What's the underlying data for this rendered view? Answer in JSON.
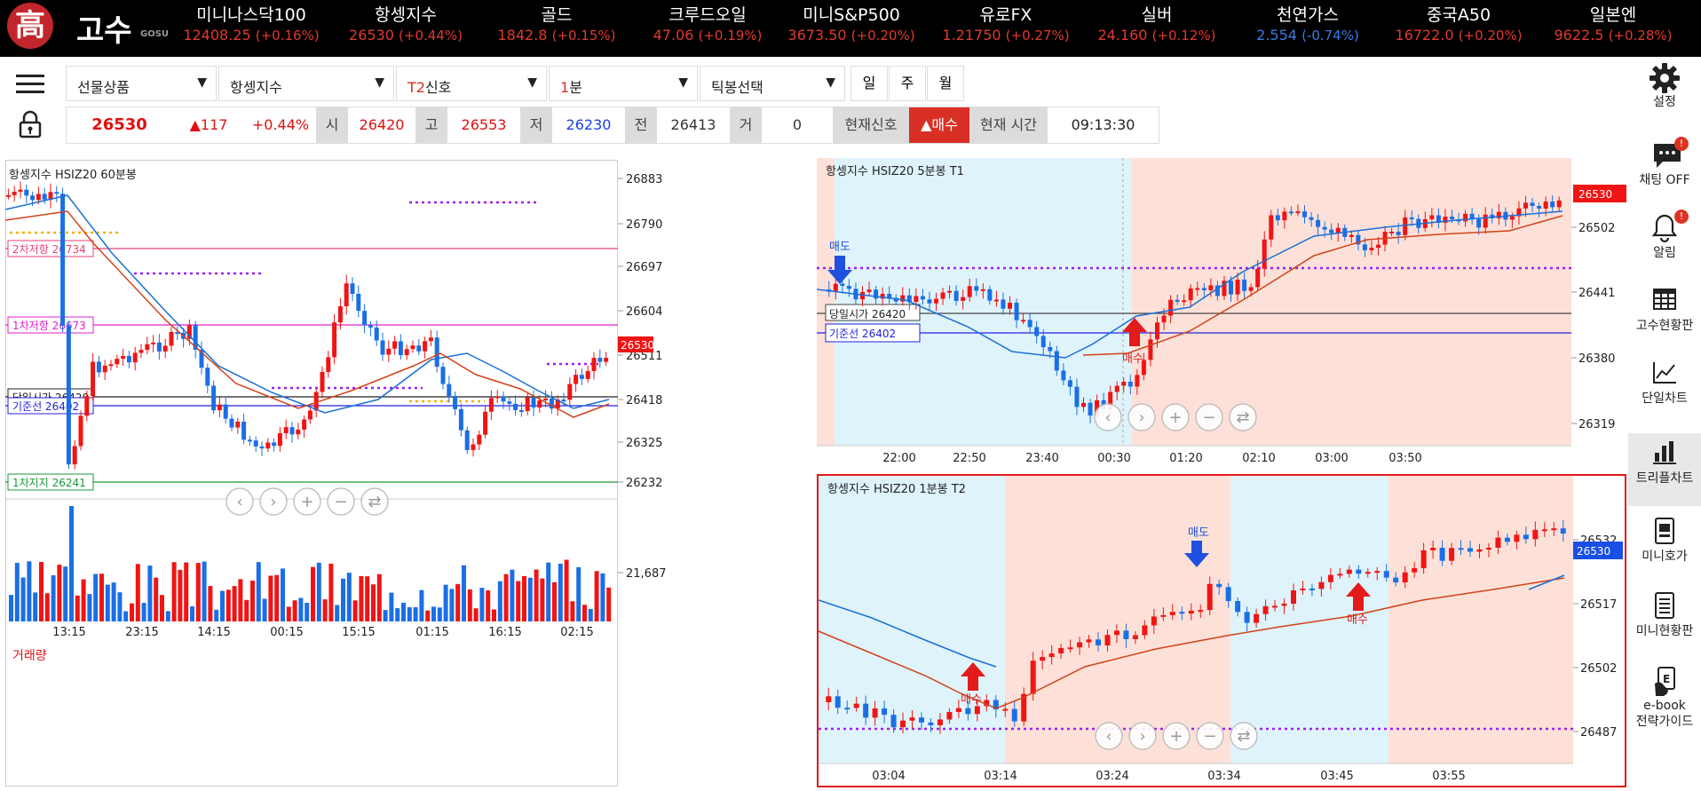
{
  "brand": {
    "logo_char": "高",
    "name": "고수",
    "sub": "GOSU"
  },
  "tickers": [
    {
      "name": "미니나스닥100",
      "price": "12408.25",
      "change": "(+0.16%)",
      "dir": "up"
    },
    {
      "name": "항셍지수",
      "price": "26530",
      "change": "(+0.44%)",
      "dir": "up"
    },
    {
      "name": "골드",
      "price": "1842.8",
      "change": "(+0.15%)",
      "dir": "up"
    },
    {
      "name": "크루드오일",
      "price": "47.06",
      "change": "(+0.19%)",
      "dir": "up"
    },
    {
      "name": "미니S&P500",
      "price": "3673.50",
      "change": "(+0.20%)",
      "dir": "up"
    },
    {
      "name": "유로FX",
      "price": "1.21750",
      "change": "(+0.27%)",
      "dir": "up"
    },
    {
      "name": "실버",
      "price": "24.160",
      "change": "(+0.12%)",
      "dir": "up"
    },
    {
      "name": "천연가스",
      "price": "2.554",
      "change": "(-0.74%)",
      "dir": "down"
    },
    {
      "name": "중국A50",
      "price": "16722.0",
      "change": "(+0.20%)",
      "dir": "up"
    },
    {
      "name": "일본엔",
      "price": "9622.5",
      "change": "(+0.28%)",
      "dir": "up"
    }
  ],
  "toolbar": {
    "product_label": "선물상품",
    "instrument": "항셍지수",
    "signal_prefix": "T2",
    "signal_suffix": "신호",
    "interval_prefix": "1",
    "interval_suffix": "분",
    "tick_select": "틱봉선택",
    "tabs": [
      "일",
      "주",
      "월"
    ]
  },
  "quote": {
    "price": "26530",
    "change": "▲117",
    "change_pct": "+0.44%",
    "open_label": "시",
    "open": "26420",
    "high_label": "고",
    "high": "26553",
    "low_label": "저",
    "low": "26230",
    "prev_label": "전",
    "prev": "26413",
    "volume_label": "거",
    "volume": "0",
    "signal_label": "현재신호",
    "signal_value": "▲매수",
    "time_label": "현재 시간",
    "time_value": "09:13:30"
  },
  "colors": {
    "up": "#f01414",
    "down": "#1a6fe6",
    "buy_zone": "#fde1d8",
    "sell_zone": "#dff3fb",
    "accent_red": "#d93025"
  },
  "chart_left": {
    "title": "항셍지수  HSIZ20  60분봉",
    "y_ticks": [
      "26883",
      "26790",
      "26697",
      "26604",
      "26511",
      "26418",
      "26325",
      "26232"
    ],
    "x_ticks": [
      "13:15",
      "23:15",
      "14:15",
      "00:15",
      "15:15",
      "01:15",
      "16:15",
      "02:15"
    ],
    "last_price": "26530",
    "levels": [
      {
        "label": "2차저항 26734"
      },
      {
        "label": "1차저항 26673"
      },
      {
        "label": "당일시가 26420"
      },
      {
        "label": "기준선 26402"
      },
      {
        "label": "1차지지 26241"
      }
    ],
    "volume_title": "거래량",
    "volume_tick": "21,687"
  },
  "chart_t1": {
    "title": "항셍지수  HSIZ20  5분봉   T1",
    "y_ticks": [
      "26502",
      "26441",
      "26380",
      "26319"
    ],
    "x_ticks": [
      "22:00",
      "22:50",
      "23:40",
      "00:30",
      "01:20",
      "02:10",
      "03:00",
      "03:50"
    ],
    "last_price": "26530",
    "levels": [
      {
        "label": "당일시가 26420"
      },
      {
        "label": "기준선 26402"
      }
    ],
    "sell_marker": "매도",
    "buy_marker": "매수"
  },
  "chart_t2": {
    "title": "항셍지수  HSIZ20  1분봉   T2",
    "y_ticks": [
      "26532",
      "26517",
      "26502",
      "26487"
    ],
    "x_ticks": [
      "03:04",
      "03:14",
      "03:24",
      "03:34",
      "03:45",
      "03:55"
    ],
    "last_price": "26530",
    "sell_marker": "매도",
    "buy_marker_1": "매수",
    "buy_marker_2": "매수"
  },
  "sidebar": [
    {
      "icon": "gear-icon",
      "label": "설정"
    },
    {
      "icon": "chat-icon",
      "label": "채팅 OFF",
      "badge": "!"
    },
    {
      "icon": "bell-icon",
      "label": "알림",
      "badge": "!"
    },
    {
      "icon": "table-icon",
      "label": "고수현황판"
    },
    {
      "icon": "line-chart-icon",
      "label": "단일차트"
    },
    {
      "icon": "bar-chart-icon",
      "label": "트리플차트",
      "active": true
    },
    {
      "icon": "mini-quote-icon",
      "label": "미니호가"
    },
    {
      "icon": "list-icon",
      "label": "미니현황판"
    },
    {
      "icon": "ebook-icon",
      "label": "e-book",
      "label2": "전략가이드"
    }
  ]
}
